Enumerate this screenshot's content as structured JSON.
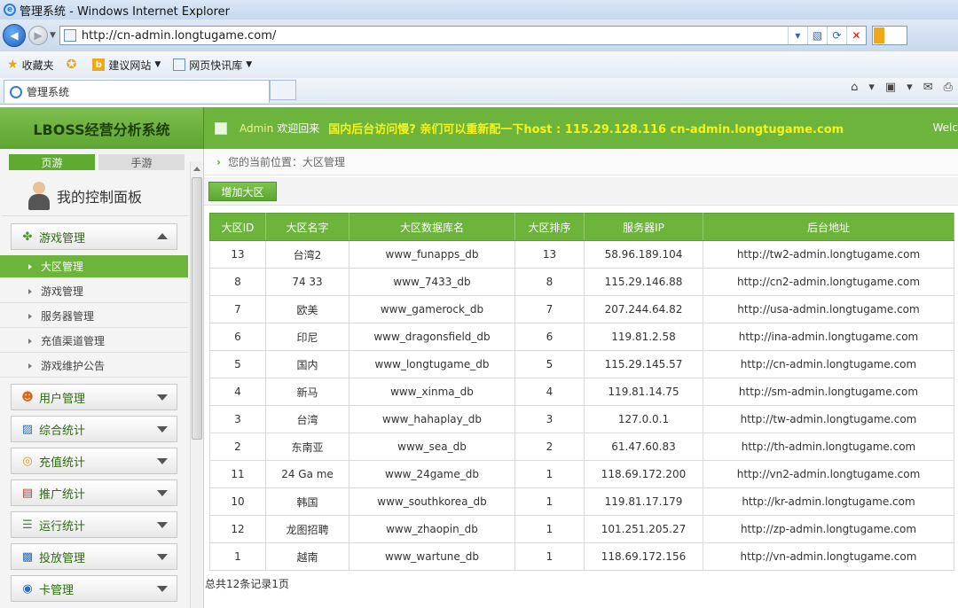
{
  "browser": {
    "window_title": "管理系统 - Windows Internet Explorer",
    "url": "http://cn-admin.longtugame.com/",
    "favorites_label": "收藏夹",
    "suggested_sites": "建议网站",
    "web_slice_gallery": "网页快讯库",
    "tab_title": "管理系统"
  },
  "header": {
    "logo": "LBOSS经营分析系统",
    "username": "Admin",
    "welcome": "欢迎回来",
    "notice": "国内后台访问慢? 亲们可以重新配一下host : 115.29.128.116 cn-admin.longtugame.com",
    "welcome_right": "Welc"
  },
  "sidebar": {
    "tabs": [
      "页游",
      "手游"
    ],
    "panel_title": "我的控制面板",
    "game_menu": "游戏管理",
    "sub_items": [
      "大区管理",
      "游戏管理",
      "服务器管理",
      "充值渠道管理",
      "游戏维护公告"
    ],
    "menus": [
      "用户管理",
      "综合统计",
      "充值统计",
      "推广统计",
      "运行统计",
      "投放管理",
      "卡管理"
    ]
  },
  "main": {
    "breadcrumb": "您的当前位置：大区管理",
    "add_button": "增加大区",
    "columns": [
      "大区ID",
      "大区名字",
      "大区数据库名",
      "大区排序",
      "服务器IP",
      "后台地址"
    ],
    "rows": [
      [
        "13",
        "台湾2",
        "www_funapps_db",
        "13",
        "58.96.189.104",
        "http://tw2-admin.longtugame.com"
      ],
      [
        "8",
        "74 33",
        "www_7433_db",
        "8",
        "115.29.146.88",
        "http://cn2-admin.longtugame.com"
      ],
      [
        "7",
        "欧美",
        "www_gamerock_db",
        "7",
        "207.244.64.82",
        "http://usa-admin.longtugame.com"
      ],
      [
        "6",
        "印尼",
        "www_dragonsfield_db",
        "6",
        "119.81.2.58",
        "http://ina-admin.longtugame.com"
      ],
      [
        "5",
        "国内",
        "www_longtugame_db",
        "5",
        "115.29.145.57",
        "http://cn-admin.longtugame.com"
      ],
      [
        "4",
        "新马",
        "www_xinma_db",
        "4",
        "119.81.14.75",
        "http://sm-admin.longtugame.com"
      ],
      [
        "3",
        "台湾",
        "www_hahaplay_db",
        "3",
        "127.0.0.1",
        "http://tw-admin.longtugame.com"
      ],
      [
        "2",
        "东南亚",
        "www_sea_db",
        "2",
        "61.47.60.83",
        "http://th-admin.longtugame.com"
      ],
      [
        "11",
        "24 Ga me",
        "www_24game_db",
        "1",
        "118.69.172.200",
        "http://vn2-admin.longtugame.com"
      ],
      [
        "10",
        "韩国",
        "www_southkorea_db",
        "1",
        "119.81.17.179",
        "http://kr-admin.longtugame.com"
      ],
      [
        "12",
        "龙图招聘",
        "www_zhaopin_db",
        "1",
        "101.251.205.27",
        "http://zp-admin.longtugame.com"
      ],
      [
        "1",
        "越南",
        "www_wartune_db",
        "1",
        "118.69.172.156",
        "http://vn-admin.longtugame.com"
      ]
    ],
    "total": "总共12条记录1页"
  }
}
